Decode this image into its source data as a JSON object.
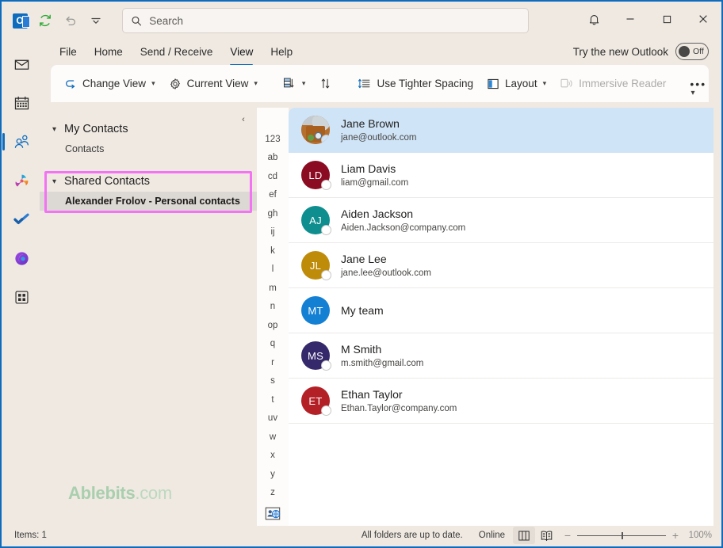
{
  "window": {
    "quick_access": [
      {
        "name": "outlook-logo",
        "label": "Outlook"
      },
      {
        "name": "send-receive-icon",
        "label": "Send/Receive All Folders"
      },
      {
        "name": "undo-icon",
        "label": "Undo"
      },
      {
        "name": "customize-qat-icon",
        "label": "Customize Quick Access Toolbar"
      }
    ],
    "controls": [
      {
        "name": "notifications-button",
        "glyph": "bell"
      },
      {
        "name": "minimize-button",
        "glyph": "minimize"
      },
      {
        "name": "maximize-button",
        "glyph": "maximize"
      },
      {
        "name": "close-button",
        "glyph": "close"
      }
    ]
  },
  "search": {
    "placeholder": "Search",
    "value": ""
  },
  "menu": {
    "tabs": [
      {
        "label": "File",
        "active": false
      },
      {
        "label": "Home",
        "active": false
      },
      {
        "label": "Send / Receive",
        "active": false
      },
      {
        "label": "View",
        "active": true
      },
      {
        "label": "Help",
        "active": false
      }
    ],
    "try_new_outlook": {
      "label": "Try the new Outlook",
      "toggle_state": "Off"
    }
  },
  "ribbon": {
    "items": [
      {
        "label": "Change View",
        "icon": "change-view-icon",
        "dropdown": true,
        "disabled": false
      },
      {
        "label": "Current View",
        "icon": "current-view-gear-icon",
        "dropdown": true,
        "disabled": false
      },
      {
        "label": "",
        "icon": "message-preview-icon",
        "dropdown": true,
        "disabled": false
      },
      {
        "label": "",
        "icon": "reverse-sort-icon",
        "dropdown": false,
        "disabled": false
      },
      {
        "label": "Use Tighter Spacing",
        "icon": "tighter-spacing-icon",
        "dropdown": false,
        "disabled": false
      },
      {
        "label": "Layout",
        "icon": "layout-icon",
        "dropdown": true,
        "disabled": false
      },
      {
        "label": "Immersive Reader",
        "icon": "immersive-reader-icon",
        "dropdown": false,
        "disabled": true
      },
      {
        "label": "•••",
        "icon": "more-commands-icon",
        "dropdown": false,
        "disabled": false
      }
    ]
  },
  "rail": {
    "items": [
      {
        "name": "mail-icon",
        "label": "Mail",
        "active": false
      },
      {
        "name": "calendar-icon",
        "label": "Calendar",
        "active": false
      },
      {
        "name": "people-icon",
        "label": "People",
        "active": true
      },
      {
        "name": "copilot-icon",
        "label": "Copilot",
        "active": false
      },
      {
        "name": "todo-icon",
        "label": "To Do",
        "active": false
      },
      {
        "name": "onenote-icon",
        "label": "OneNote",
        "active": false
      },
      {
        "name": "more-apps-icon",
        "label": "More apps",
        "active": false
      }
    ]
  },
  "folder_pane": {
    "collapse_label": "‹",
    "groups": [
      {
        "label": "My Contacts",
        "expanded": true,
        "items": [
          {
            "label": "Contacts",
            "selected": false
          }
        ]
      },
      {
        "label": "Shared Contacts",
        "expanded": true,
        "highlighted": true,
        "items": [
          {
            "label": "Alexander Frolov - Personal contacts",
            "selected": true
          }
        ]
      }
    ]
  },
  "watermark": {
    "brand": "Ablebits",
    "suffix": ".com"
  },
  "alpha_index": {
    "entries": [
      "123",
      "ab",
      "cd",
      "ef",
      "gh",
      "ij",
      "k",
      "l",
      "m",
      "n",
      "op",
      "q",
      "r",
      "s",
      "t",
      "uv",
      "w",
      "x",
      "y",
      "z"
    ],
    "bottom_icon": "address-book-globe-icon"
  },
  "contacts": [
    {
      "name": "Jane Brown",
      "email": "jane@outlook.com",
      "initials": "",
      "avatar_type": "photo",
      "avatar_color": "#b5703a",
      "selected": true,
      "presence": "offline"
    },
    {
      "name": "Liam Davis",
      "email": "liam@gmail.com",
      "initials": "LD",
      "avatar_type": "initials",
      "avatar_color": "#8b0b22",
      "selected": false,
      "presence": "offline"
    },
    {
      "name": "Aiden Jackson",
      "email": "Aiden.Jackson@company.com",
      "initials": "AJ",
      "avatar_type": "initials",
      "avatar_color": "#0e8e8e",
      "selected": false,
      "presence": "offline"
    },
    {
      "name": "Jane Lee",
      "email": "jane.lee@outlook.com",
      "initials": "JL",
      "avatar_type": "initials",
      "avatar_color": "#bf8c0a",
      "selected": false,
      "presence": "offline"
    },
    {
      "name": "My team",
      "email": "",
      "initials": "MT",
      "avatar_type": "initials",
      "avatar_color": "#1480d4",
      "selected": false,
      "presence": "none"
    },
    {
      "name": "M Smith",
      "email": "m.smith@gmail.com",
      "initials": "MS",
      "avatar_type": "initials",
      "avatar_color": "#36296b",
      "selected": false,
      "presence": "offline"
    },
    {
      "name": "Ethan Taylor",
      "email": "Ethan.Taylor@company.com",
      "initials": "ET",
      "avatar_type": "initials",
      "avatar_color": "#b32026",
      "selected": false,
      "presence": "offline"
    }
  ],
  "status_bar": {
    "items_count": "Items: 1",
    "sync_status": "All folders are up to date.",
    "connection": "Online",
    "view_buttons": [
      {
        "name": "normal-view-button",
        "active": true
      },
      {
        "name": "reading-view-button",
        "active": false
      }
    ],
    "zoom": {
      "minus": "−",
      "plus": "+",
      "level": "100%"
    }
  },
  "colors": {
    "accent": "#0f6cbd",
    "chrome": "#efe9e2",
    "selection": "#cfe4f7",
    "highlight_box": "#f472f4",
    "watermark": "#a9cfae"
  }
}
